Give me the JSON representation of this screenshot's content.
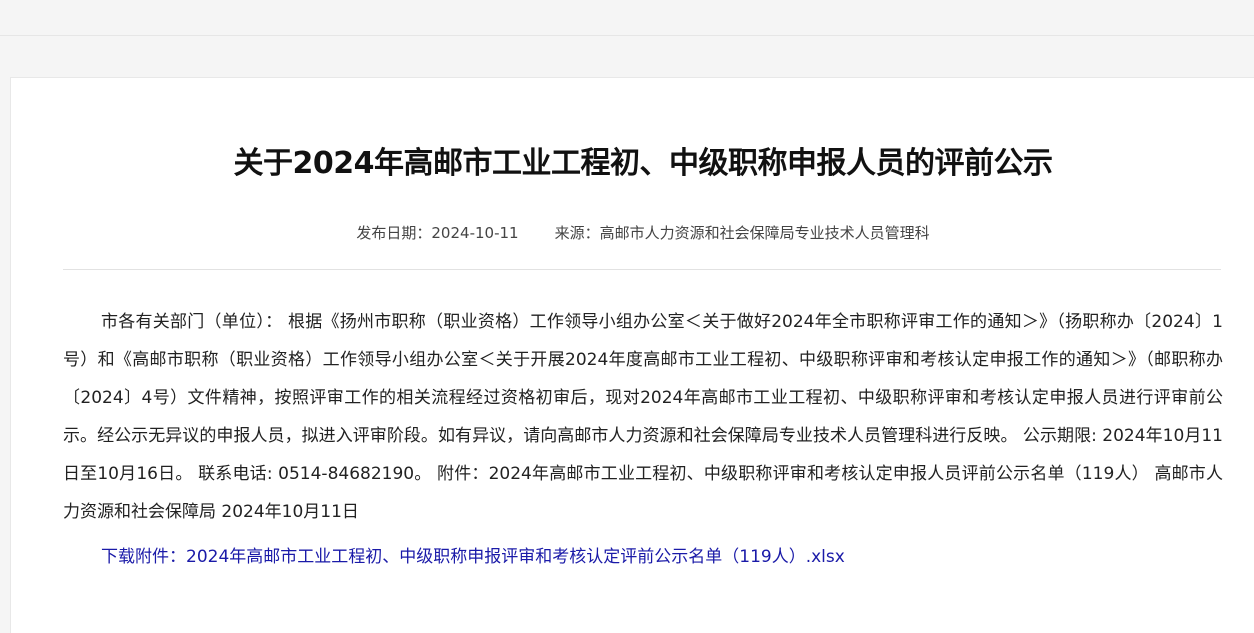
{
  "article": {
    "title": "关于2024年高邮市工业工程初、中级职称申报人员的评前公示",
    "publish_label": "发布日期：",
    "publish_date": "2024-10-11",
    "source_label": "来源：",
    "source": "高邮市人力资源和社会保障局专业技术人员管理科",
    "body": "市各有关部门（单位）： 根据《扬州市职称（职业资格）工作领导小组办公室＜关于做好2024年全市职称评审工作的通知＞》（扬职称办〔2024〕1号）和《高邮市职称（职业资格）工作领导小组办公室＜关于开展2024年度高邮市工业工程初、中级职称评审和考核认定申报工作的通知＞》（邮职称办〔2024〕4号）文件精神，按照评审工作的相关流程经过资格初审后，现对2024年高邮市工业工程初、中级职称评审和考核认定申报人员进行评审前公示。经公示无异议的申报人员，拟进入评审阶段。如有异议，请向高邮市人力资源和社会保障局专业技术人员管理科进行反映。 公示期限: 2024年10月11日至10月16日。 联系电话: 0514-84682190。 附件：2024年高邮市工业工程初、中级职称评审和考核认定申报人员评前公示名单（119人） 高邮市人力资源和社会保障局 2024年10月11日",
    "attachment_label": "下载附件：",
    "attachment_name": "2024年高邮市工业工程初、中级职称申报评审和考核认定评前公示名单（119人）.xlsx"
  },
  "colors": {
    "link": "#1a1aa8",
    "title": "#111111",
    "text": "#222222"
  }
}
